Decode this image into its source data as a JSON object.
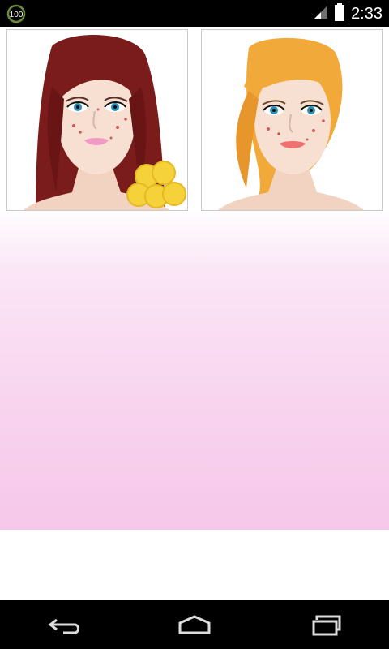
{
  "status_bar": {
    "notification_badge": "100",
    "clock": "2:33",
    "icons": [
      "signal-icon",
      "battery-icon"
    ]
  },
  "gallery": {
    "items": [
      {
        "id": "hairstyle-1",
        "hair_color": "#7b1c1c",
        "has_coin_badge": true
      },
      {
        "id": "hairstyle-2",
        "hair_color": "#f1a93a",
        "has_coin_badge": false
      }
    ]
  },
  "navigation": {
    "buttons": [
      "back-button",
      "home-button",
      "recent-apps-button"
    ]
  },
  "colors": {
    "accent_pink": "#f6c7ea",
    "coin_gold": "#f5d23a"
  }
}
